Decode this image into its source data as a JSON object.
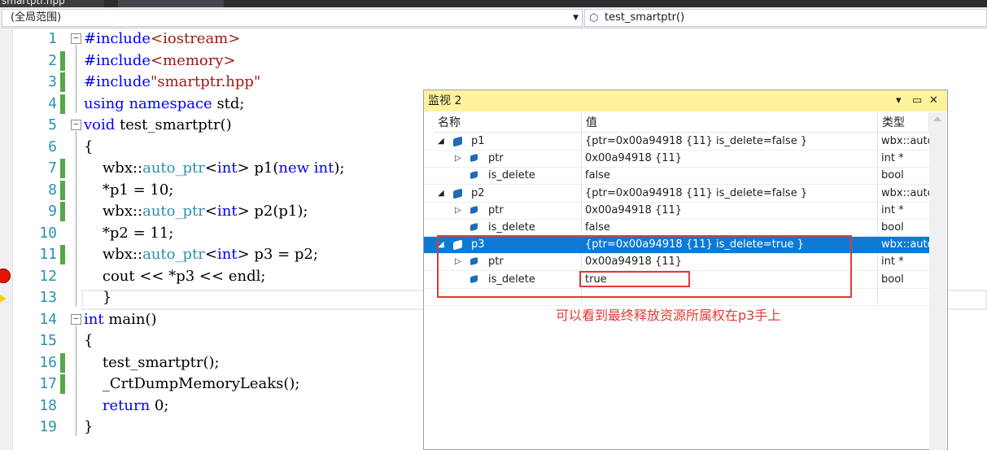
{
  "tabs": {
    "active_label": "smartptr.hpp"
  },
  "navbar": {
    "scope": "(全局范围)",
    "function": "test_smartptr()"
  },
  "editor": {
    "line_numbers": [
      "1",
      "2",
      "3",
      "4",
      "5",
      "6",
      "7",
      "8",
      "9",
      "10",
      "11",
      "12",
      "13",
      "14",
      "15",
      "16",
      "17",
      "18",
      "19"
    ],
    "lines": [
      [
        [
          "kw",
          "#include"
        ],
        [
          "st",
          "<iostream>"
        ]
      ],
      [
        [
          "kw",
          "#include"
        ],
        [
          "st",
          "<memory>"
        ]
      ],
      [
        [
          "kw",
          "#include"
        ],
        [
          "st",
          "\"smartptr.hpp\""
        ]
      ],
      [
        [
          "kw",
          "using"
        ],
        [
          "",
          "​ "
        ],
        [
          "kw",
          "namespace"
        ],
        [
          "",
          " std;"
        ]
      ],
      [
        [
          "kw",
          "void"
        ],
        [
          "",
          " test_smartptr()"
        ]
      ],
      [
        [
          "",
          "{"
        ]
      ],
      [
        [
          "",
          "    wbx::"
        ],
        [
          "ty",
          "auto_ptr"
        ],
        [
          "",
          "<"
        ],
        [
          "kw",
          "int"
        ],
        [
          "",
          "> p1("
        ],
        [
          "kw",
          "new"
        ],
        [
          "",
          " "
        ],
        [
          "kw",
          "int"
        ],
        [
          "",
          ");"
        ]
      ],
      [
        [
          "",
          "    *p1 = 10;"
        ]
      ],
      [
        [
          "",
          "    wbx::"
        ],
        [
          "ty",
          "auto_ptr"
        ],
        [
          "",
          "<"
        ],
        [
          "kw",
          "int"
        ],
        [
          "",
          "> p2(p1);"
        ]
      ],
      [
        [
          "",
          "    *p2 = 11;"
        ]
      ],
      [
        [
          "",
          "    wbx::"
        ],
        [
          "ty",
          "auto_ptr"
        ],
        [
          "",
          "<"
        ],
        [
          "kw",
          "int"
        ],
        [
          "",
          "> p3 = p2;"
        ]
      ],
      [
        [
          "",
          "    cout << *p3 << endl;"
        ]
      ],
      [
        [
          "",
          "    }"
        ]
      ],
      [
        [
          "kw",
          "int"
        ],
        [
          "",
          " main()"
        ]
      ],
      [
        [
          "",
          "{"
        ]
      ],
      [
        [
          "",
          "    test_smartptr();"
        ]
      ],
      [
        [
          "",
          "    _CrtDumpMemoryLeaks();"
        ]
      ],
      [
        [
          "",
          "    "
        ],
        [
          "kw",
          "return"
        ],
        [
          "",
          " 0;"
        ]
      ],
      [
        [
          "",
          "}"
        ]
      ]
    ]
  },
  "watch": {
    "title": "监视 2",
    "columns": {
      "name": "名称",
      "value": "值",
      "type": "类型"
    },
    "rows": [
      {
        "name": "p1",
        "value": "{ptr=0x00a94918 {11} is_delete=false }",
        "type": "wbx::auto",
        "expander": "◢"
      },
      {
        "name": "ptr",
        "value": "0x00a94918 {11}",
        "type": "int *",
        "expander": "▷"
      },
      {
        "name": "is_delete",
        "value": "false",
        "type": "bool",
        "expander": ""
      },
      {
        "name": "p2",
        "value": "{ptr=0x00a94918 {11} is_delete=false }",
        "type": "wbx::auto",
        "expander": "◢"
      },
      {
        "name": "ptr",
        "value": "0x00a94918 {11}",
        "type": "int *",
        "expander": "▷"
      },
      {
        "name": "is_delete",
        "value": "false",
        "type": "bool",
        "expander": ""
      },
      {
        "name": "p3",
        "value": "{ptr=0x00a94918 {11} is_delete=true }",
        "type": "wbx::auto",
        "expander": "◢"
      },
      {
        "name": "ptr",
        "value": "0x00a94918 {11}",
        "type": "int *",
        "expander": "▷"
      },
      {
        "name": "is_delete",
        "value": "true",
        "type": "bool",
        "expander": ""
      }
    ],
    "selected_row": 6
  },
  "annotation": "可以看到最终释放资源所属权在p3手上",
  "colors": {
    "keyword": "#0000ff",
    "type": "#2b91af",
    "string": "#a31515",
    "selection": "#0e7ad3",
    "annotation": "#e23a35",
    "watch_title": "#fff29d"
  }
}
